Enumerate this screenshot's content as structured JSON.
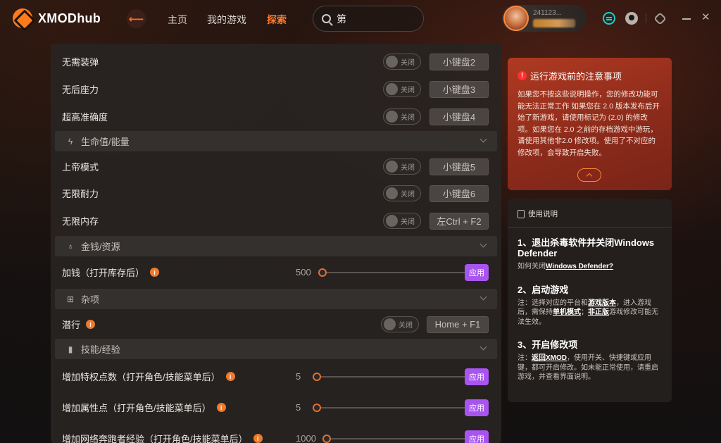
{
  "app": {
    "logo_text": "XMODhub",
    "back_icon": "arrow-left-icon"
  },
  "nav": {
    "home": "主页",
    "my_games": "我的游戏",
    "explore": "探索"
  },
  "search": {
    "value": "第",
    "icon": "search-icon"
  },
  "user": {
    "name_partial": "241123..."
  },
  "rows": {
    "no_reload": {
      "label": "无需装弹",
      "toggle": "关闭",
      "hotkey": "小键盘2"
    },
    "no_recoil": {
      "label": "无后座力",
      "toggle": "关闭",
      "hotkey": "小键盘3"
    },
    "accuracy": {
      "label": "超高准确度",
      "toggle": "关闭",
      "hotkey": "小键盘4"
    },
    "god_mode": {
      "label": "上帝模式",
      "toggle": "关闭",
      "hotkey": "小键盘5"
    },
    "stamina": {
      "label": "无限耐力",
      "toggle": "关闭",
      "hotkey": "小键盘6"
    },
    "memory": {
      "label": "无限内存",
      "toggle": "关闭",
      "hotkey": "左Ctrl + F2"
    },
    "add_money": {
      "label": "加钱（打开库存后）",
      "value": "500",
      "apply": "应用"
    },
    "stealth": {
      "label": "潜行",
      "toggle": "关闭",
      "hotkey": "Home + F1"
    },
    "perk_points": {
      "label": "增加特权点数（打开角色/技能菜单后）",
      "value": "5",
      "apply": "应用"
    },
    "attr_points": {
      "label": "增加属性点（打开角色/技能菜单后）",
      "value": "5",
      "apply": "应用"
    },
    "netrunner_xp": {
      "label": "增加网络奔跑者经验（打开角色/技能菜单后）",
      "value": "1000",
      "apply": "应用"
    }
  },
  "sections": {
    "health": "生命值/能量",
    "money": "金钱/资源",
    "misc": "杂项",
    "skills": "技能/经验"
  },
  "notice": {
    "title": "运行游戏前的注意事项",
    "body": "如果您不按这些说明操作，您的修改功能可能无法正常工作 如果您在 2.0 版本发布后开始了新游戏，请使用标记为 (2.0) 的修改项。如果您在 2.0 之前的存档游戏中游玩，请使用其他非2.0 修改项。使用了不对应的修改项，会导致开启失败。"
  },
  "guide": {
    "title": "使用说明",
    "step1_head": "1、退出杀毒软件并关闭Windows Defender",
    "step1_prefix": "如何关闭",
    "step1_link": "Windows Defender?",
    "step2_head": "2、启动游戏",
    "step2_a": "注：选择对应的平台和",
    "step2_link1": "游戏版本",
    "step2_b": "，进入游戏后，需保持",
    "step2_link2": "单机模式",
    "step2_c": "；",
    "step2_link3": "非正版",
    "step2_d": "游戏修改可能无法生效。",
    "step3_head": "3、开启修改项",
    "step3_a": "注：",
    "step3_link": "返回XMOD",
    "step3_b": "，使用开关、快捷键或应用键，都可开启修改。如未能正常使用，请重启游戏，并查看界面说明。"
  }
}
